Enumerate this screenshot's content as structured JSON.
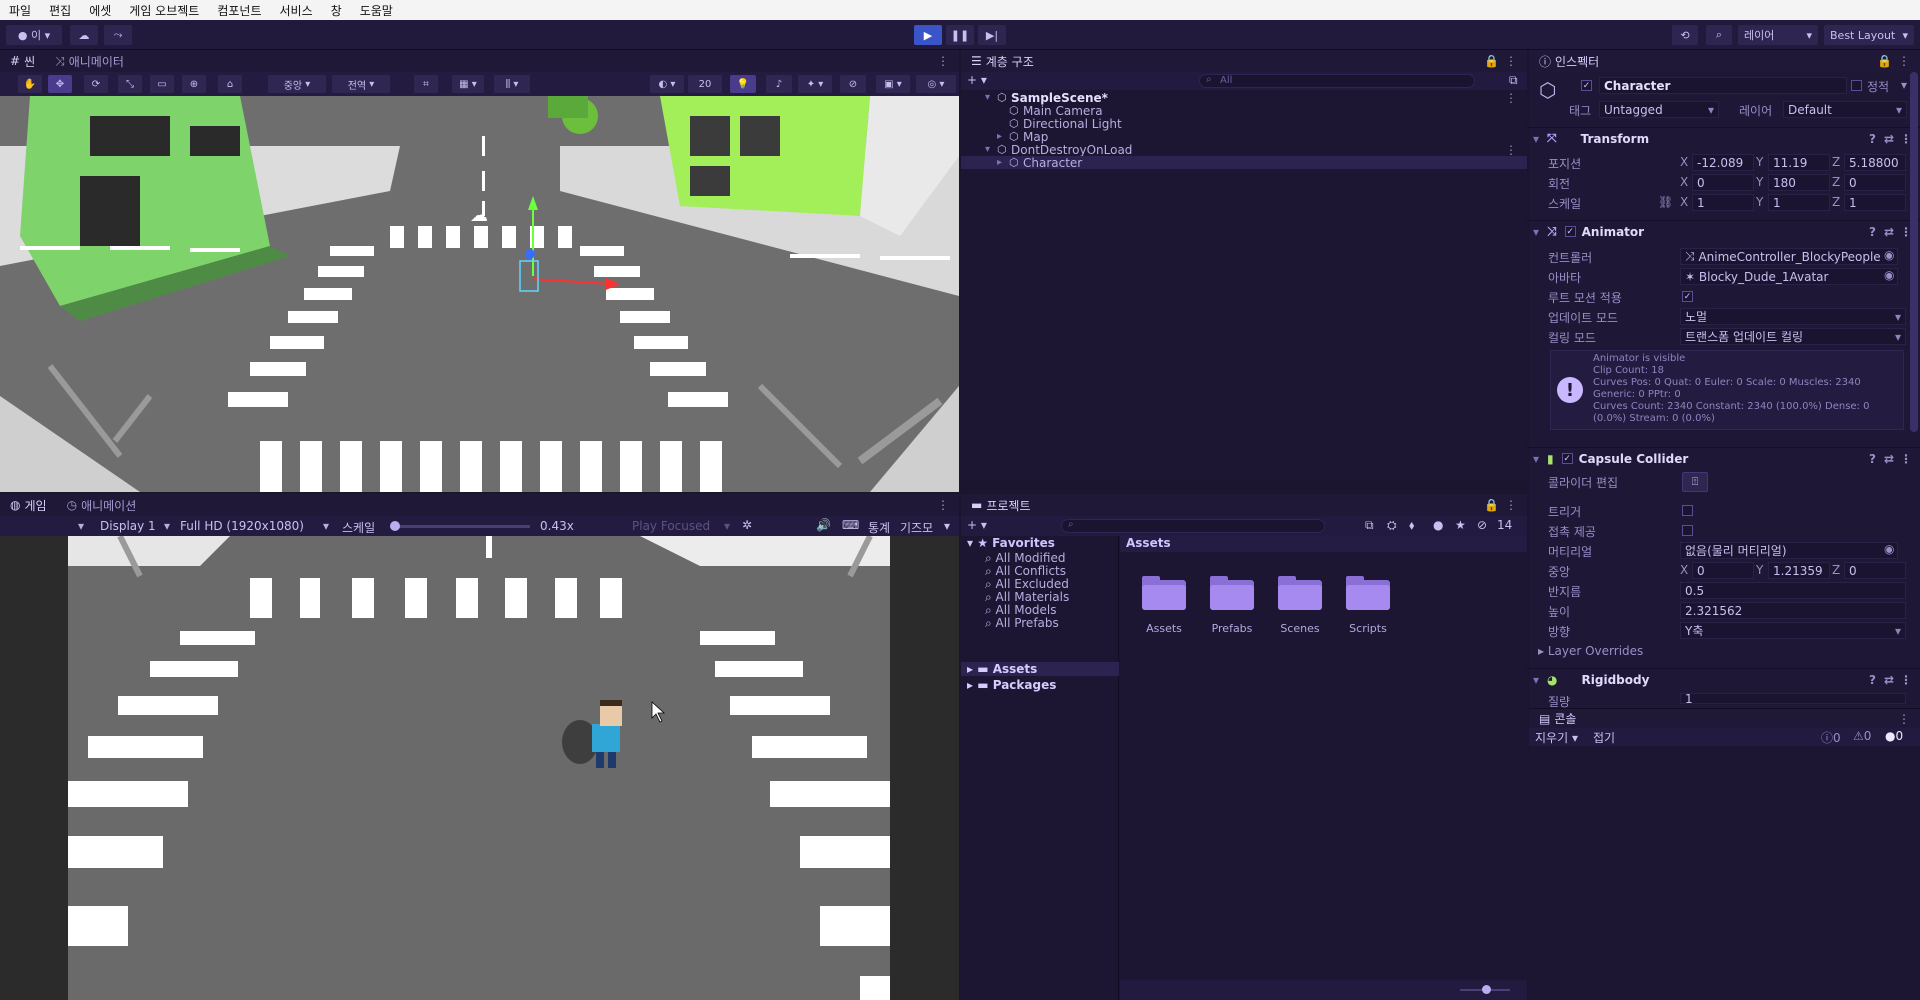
{
  "menu": [
    "파일",
    "편집",
    "에셋",
    "게임 오브젝트",
    "컴포넌트",
    "서비스",
    "창",
    "도움말"
  ],
  "toolbar": {
    "account_label": "이",
    "layers_label": "레이어",
    "layout_label": "Best Layout"
  },
  "scene_panel": {
    "tabs": [
      "씬",
      "애니메이터"
    ],
    "pivot_label": "중앙",
    "space_label": "전역",
    "grid_size": "20"
  },
  "hierarchy": {
    "tab": "계층 구조",
    "search_placeholder": "All",
    "items": [
      {
        "label": "SampleScene*",
        "level": 0,
        "bold": true
      },
      {
        "label": "Main Camera",
        "level": 1
      },
      {
        "label": "Directional Light",
        "level": 1
      },
      {
        "label": "Map",
        "level": 1
      },
      {
        "label": "DontDestroyOnLoad",
        "level": 0
      },
      {
        "label": "Character",
        "level": 1
      }
    ]
  },
  "game_panel": {
    "tabs": [
      "게임",
      "애니메이션"
    ],
    "display": "Display 1",
    "resolution": "Full HD (1920x1080)",
    "scale_label": "스케일",
    "scale_value": 0.43,
    "scale_text": "0.43x",
    "play_mode": "Play Focused",
    "stats_label": "통계",
    "gizmos_label": "기즈모"
  },
  "project": {
    "tab": "프로젝트",
    "favorites_title": "Favorites",
    "favorites": [
      "All Modified",
      "All Conflicts",
      "All Excluded",
      "All Materials",
      "All Models",
      "All Prefabs"
    ],
    "tree": [
      "Assets",
      "Packages"
    ],
    "breadcrumb": "Assets",
    "hidden_count": "14",
    "folders": [
      "Assets",
      "Prefabs",
      "Scenes",
      "Scripts"
    ]
  },
  "inspector": {
    "tab": "인스펙터",
    "object_name": "Character",
    "static_label": "정적",
    "tag_label": "태그",
    "tag_value": "Untagged",
    "layer_label": "레이어",
    "layer_value": "Default",
    "transform": {
      "title": "Transform",
      "position_label": "포지션",
      "rotation_label": "회전",
      "scale_label": "스케일",
      "position": [
        "-12.089",
        "11.19",
        "5.18800"
      ],
      "rotation": [
        "0",
        "180",
        "0"
      ],
      "scale": [
        "1",
        "1",
        "1"
      ]
    },
    "animator": {
      "title": "Animator",
      "controller_label": "컨트롤러",
      "controller_value": "AnimeController_BlockyPeople",
      "avatar_label": "아바타",
      "avatar_value": "Blocky_Dude_1Avatar",
      "root_motion_label": "루트 모션 적용",
      "update_mode_label": "업데이트 모드",
      "update_mode_value": "노멀",
      "culling_label": "컬링 모드",
      "culling_value": "트랜스폼 업데이트 컬링",
      "info_lines": [
        "Animator is visible",
        "Clip Count: 18",
        "Curves Pos: 0 Quat: 0 Euler: 0 Scale: 0 Muscles: 2340",
        "Generic: 0 PPtr: 0",
        "Curves Count: 2340 Constant: 2340 (100.0%) Dense: 0",
        "(0.0%) Stream: 0 (0.0%)"
      ]
    },
    "capsule": {
      "title": "Capsule Collider",
      "edit_label": "콜라이더 편집",
      "trigger_label": "트리거",
      "contact_label": "접촉 제공",
      "material_label": "머티리얼",
      "material_value": "없음(물리 머티리얼)",
      "center_label": "중앙",
      "center": [
        "0",
        "1.21359",
        "0"
      ],
      "radius_label": "반지름",
      "radius_value": "0.5",
      "height_label": "높이",
      "height_value": "2.321562",
      "direction_label": "방향",
      "direction_value": "Y축",
      "layer_overrides": "Layer Overrides"
    },
    "rigidbody": {
      "title": "Rigidbody",
      "mass_label": "질량",
      "mass_value": "1"
    }
  },
  "console": {
    "tab": "콘솔",
    "clear_label": "지우기",
    "collapse_label": "접기",
    "log_count": "0",
    "warn_count": "0",
    "error_count": "0"
  },
  "colors": {
    "panel_bg": "#1b1530",
    "accent": "#3a55c9",
    "folder": "#a68af0",
    "road": "#6f6f6f",
    "building_green": "#7ed36b"
  }
}
